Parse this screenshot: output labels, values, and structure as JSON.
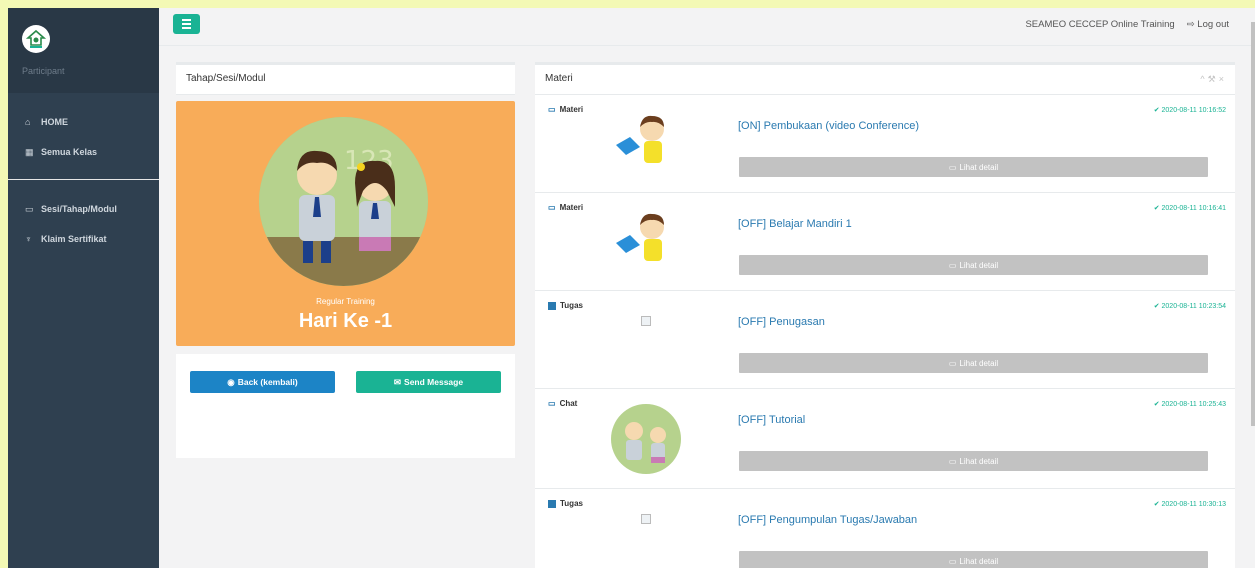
{
  "sidebar": {
    "role": "Participant",
    "nav": [
      {
        "icon": "home-icon",
        "glyph": "⌂",
        "label": "HOME"
      },
      {
        "icon": "calendar-icon",
        "glyph": "▦",
        "label": "Semua Kelas"
      }
    ],
    "nav2": [
      {
        "icon": "folder-icon",
        "glyph": "▭",
        "label": "Sesi/Tahap/Modul"
      },
      {
        "icon": "trophy-icon",
        "glyph": "♆",
        "label": "Klaim Sertifikat"
      }
    ]
  },
  "topbar": {
    "site": "SEAMEO CECCEP Online Training",
    "logout": "Log out"
  },
  "left_panel": {
    "title": "Tahap/Sesi/Modul",
    "subtitle": "Regular Training",
    "day": "Hari Ke -1",
    "back_label": "Back (kembali)",
    "send_label": "Send Message"
  },
  "right_panel": {
    "title": "Materi",
    "detail_label": "Lihat detail",
    "items": [
      {
        "type": "Materi",
        "title": "[ON] Pembukaan (video Conference)",
        "date": "2020-08-11 10:16:52"
      },
      {
        "type": "Materi",
        "title": "[OFF] Belajar Mandiri 1",
        "date": "2020-08-11 10:16:41"
      },
      {
        "type": "Tugas",
        "title": "[OFF] Penugasan",
        "date": "2020-08-11 10:23:54"
      },
      {
        "type": "Chat",
        "title": "[OFF] Tutorial",
        "date": "2020-08-11 10:25:43"
      },
      {
        "type": "Tugas",
        "title": "[OFF] Pengumpulan Tugas/Jawaban",
        "date": "2020-08-11 10:30:13"
      }
    ]
  },
  "colors": {
    "primary": "#1ab394",
    "info": "#1c84c6",
    "warning": "#f8ac59",
    "sidebar": "#2f4050",
    "disabled": "#c2c2c2"
  }
}
